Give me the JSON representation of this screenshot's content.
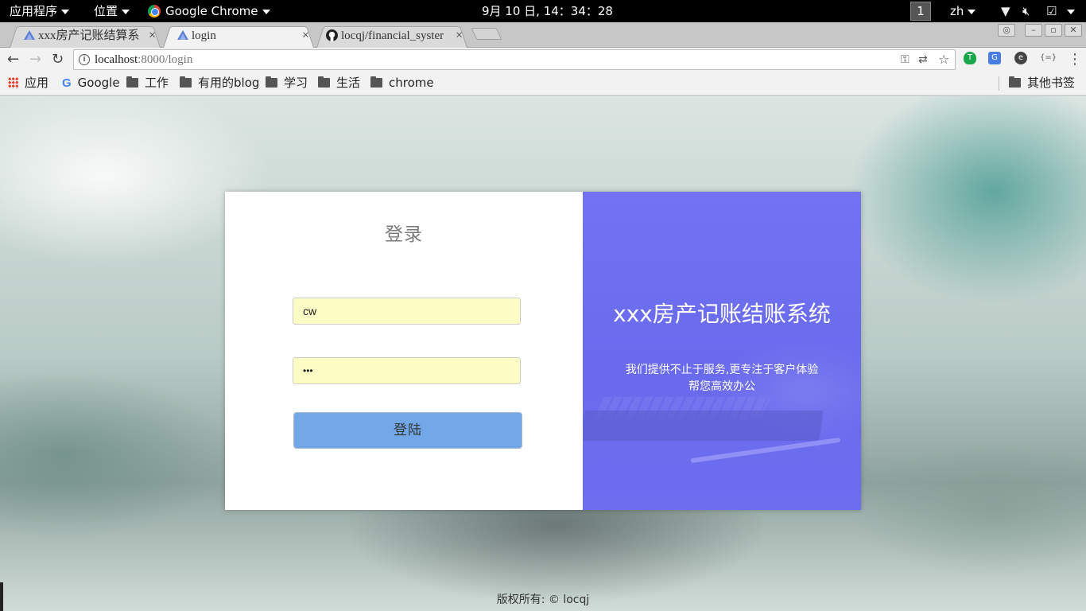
{
  "topbar": {
    "apps_menu": "应用程序",
    "places_menu": "位置",
    "active_app": "Google Chrome",
    "clock": "9月 10 日, 14：34：28",
    "workspace": "1",
    "language": "zh"
  },
  "tabs": [
    {
      "title": "xxx房产记账结算系",
      "active": false,
      "favicon": "triangle-logo-icon"
    },
    {
      "title": "login",
      "active": true,
      "favicon": "triangle-logo-icon"
    },
    {
      "title": "locqj/financial_syster",
      "active": false,
      "favicon": "github-icon"
    }
  ],
  "tab_close_glyph": "×",
  "address_bar": {
    "host": "localhost",
    "rest": ":8000/login"
  },
  "bookmarks": {
    "apps": "应用",
    "google": "Google",
    "folders": [
      "工作",
      "有用的blog",
      "学习",
      "生活",
      "chrome"
    ],
    "other": "其他书签"
  },
  "login": {
    "title": "登录",
    "username_value": "cw",
    "password_value": "•••",
    "submit_label": "登陆"
  },
  "brand": {
    "title": "xxx房产记账结账系统",
    "subtitle_line1": "我们提供不止于服务,更专注于客户体验",
    "subtitle_line2": "帮您高效办公"
  },
  "footer": "版权所有: © locqj",
  "colors": {
    "brand_panel": "#7070f0",
    "login_button": "#72a8e7",
    "autofill_field": "#fbfdc5"
  }
}
